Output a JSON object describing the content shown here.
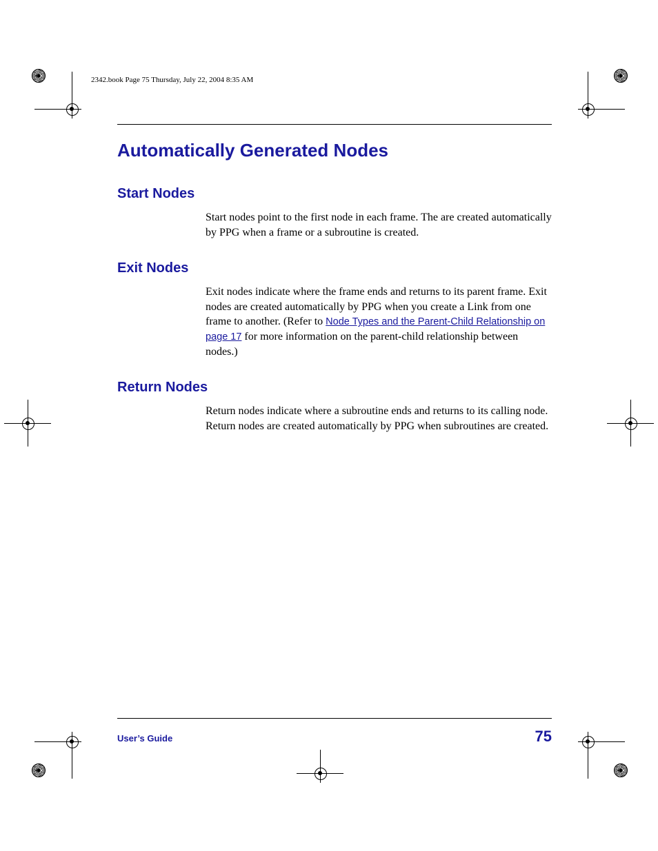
{
  "header": {
    "running_head": "2342.book  Page 75  Thursday, July 22, 2004  8:35 AM"
  },
  "title": "Automatically Generated Nodes",
  "sections": [
    {
      "heading": "Start Nodes",
      "body_pre": "Start nodes point to the first node in each frame. The are created automatically by PPG when a frame or a subroutine is created.",
      "link": "",
      "body_post": ""
    },
    {
      "heading": "Exit Nodes",
      "body_pre": "Exit nodes indicate where the frame ends and returns to its parent frame. Exit nodes are created automatically by PPG when you create a Link from one frame to another. (Refer to ",
      "link": "Node Types and the Parent-Child Relationship on page 17",
      "body_post": " for more information on the parent-child relationship between nodes.)"
    },
    {
      "heading": "Return Nodes",
      "body_pre": "Return nodes indicate where a subroutine ends and returns to its calling node. Return nodes are created automatically by PPG when subroutines are created.",
      "link": "",
      "body_post": ""
    }
  ],
  "footer": {
    "doc_label": "User’s Guide",
    "page_number": "75"
  }
}
